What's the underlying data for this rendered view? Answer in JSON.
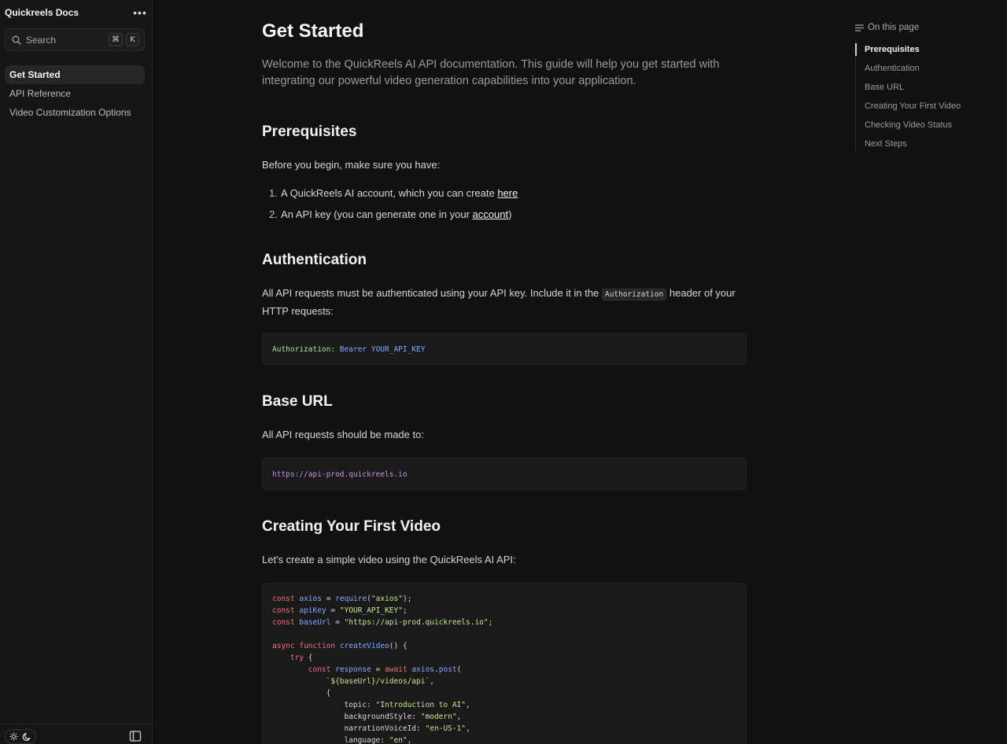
{
  "sidebar": {
    "brand": "Quickreels Docs",
    "more_label": "•••",
    "search": {
      "label": "Search",
      "shortcut_mod": "⌘",
      "shortcut_key": "K"
    },
    "items": [
      {
        "label": "Get Started",
        "active": true
      },
      {
        "label": "API Reference",
        "active": false
      },
      {
        "label": "Video Customization Options",
        "active": false
      }
    ]
  },
  "main": {
    "title": "Get Started",
    "lead": "Welcome to the QuickReels AI API documentation. This guide will help you get started with integrating our powerful video generation capabilities into your application.",
    "prerequisites": {
      "heading": "Prerequisites",
      "intro": "Before you begin, make sure you have:",
      "item1_num": "1.",
      "item1_text": "A QuickReels AI account, which you can create ",
      "item1_link": "here",
      "item2_num": "2.",
      "item2_text": "An API key (you can generate one in your ",
      "item2_link": "account",
      "item2_close": ")"
    },
    "authentication": {
      "heading": "Authentication",
      "text_before": "All API requests must be authenticated using your API key. Include it in the ",
      "inline_code": "Authorization",
      "text_after": " header of your HTTP requests:",
      "code_key": "Authorization:",
      "code_bearer": " Bearer ",
      "code_value": "YOUR_API_KEY"
    },
    "base_url": {
      "heading": "Base URL",
      "text": "All API requests should be made to:",
      "code": "https://api-prod.quickreels.io"
    },
    "first_video": {
      "heading": "Creating Your First Video",
      "text": "Let's create a simple video using the QuickReels AI API:",
      "code_lines": [
        "const axios = require(\"axios\");",
        "const apiKey = \"YOUR_API_KEY\";",
        "const baseUrl = \"https://api-prod.quickreels.io\";",
        "",
        "async function createVideo() {",
        "    try {",
        "        const response = await axios.post(",
        "            `${baseUrl}/videos/api`,",
        "            {",
        "                topic: \"Introduction to AI\",",
        "                backgroundStyle: \"modern\",",
        "                narrationVoiceId: \"en-US-1\",",
        "                language: \"en\","
      ]
    }
  },
  "toc": {
    "title": "On this page",
    "items": [
      {
        "label": "Prerequisites",
        "active": true
      },
      {
        "label": "Authentication",
        "active": false
      },
      {
        "label": "Base URL",
        "active": false
      },
      {
        "label": "Creating Your First Video",
        "active": false
      },
      {
        "label": "Checking Video Status",
        "active": false
      },
      {
        "label": "Next Steps",
        "active": false
      }
    ]
  }
}
